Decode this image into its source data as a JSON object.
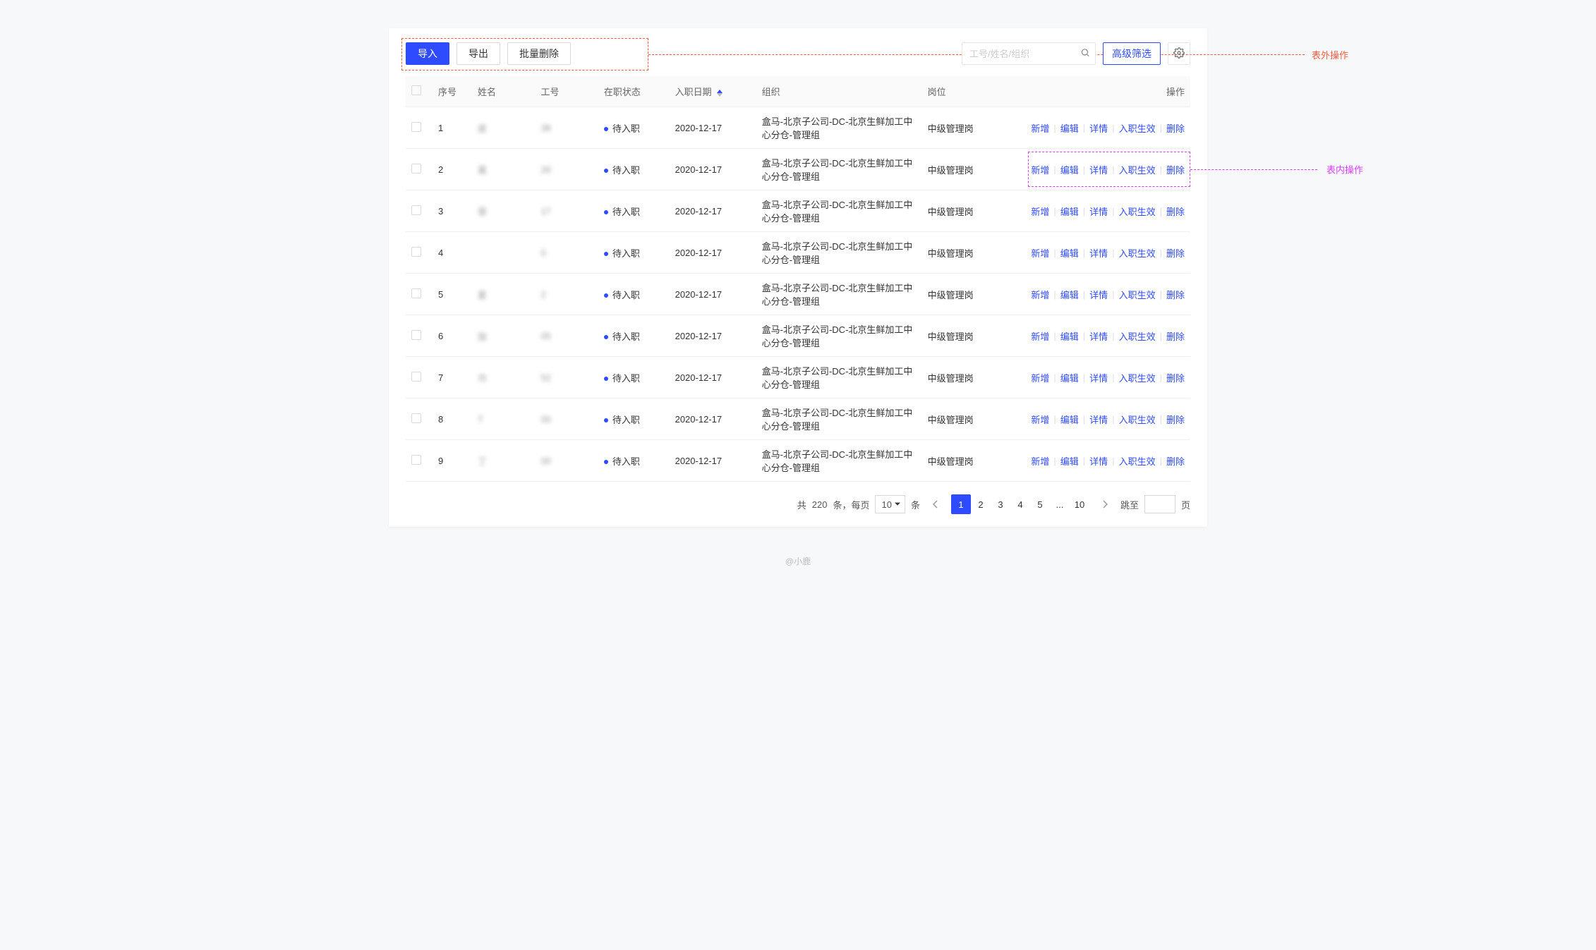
{
  "toolbar": {
    "import_label": "导入",
    "export_label": "导出",
    "bulk_delete_label": "批量删除",
    "search_placeholder": "工号/姓名/组织",
    "adv_filter_label": "高级筛选"
  },
  "annotations": {
    "outer_label": "表外操作",
    "inner_label": "表内操作"
  },
  "columns": {
    "idx": "序号",
    "name": "姓名",
    "empId": "工号",
    "status": "在职状态",
    "joinDate": "入职日期",
    "org": "组织",
    "position": "岗位",
    "action": "操作"
  },
  "rowActions": [
    "新增",
    "编辑",
    "详情",
    "入职生效",
    "删除"
  ],
  "rows": [
    {
      "idx": "1",
      "name": "皮",
      "empId": "38",
      "status": "待入职",
      "date": "2020-12-17",
      "org": "盒马-北京子公司-DC-北京生鲜加工中心分仓-管理组",
      "pos": "中级管理岗"
    },
    {
      "idx": "2",
      "name": "昊",
      "empId": "26",
      "status": "待入职",
      "date": "2020-12-17",
      "org": "盒马-北京子公司-DC-北京生鲜加工中心分仓-管理组",
      "pos": "中级管理岗"
    },
    {
      "idx": "3",
      "name": "菲",
      "empId": "17",
      "status": "待入职",
      "date": "2020-12-17",
      "org": "盒马-北京子公司-DC-北京生鲜加工中心分仓-管理组",
      "pos": "中级管理岗"
    },
    {
      "idx": "4",
      "name": "",
      "empId": "0",
      "status": "待入职",
      "date": "2020-12-17",
      "org": "盒马-北京子公司-DC-北京生鲜加工中心分仓-管理组",
      "pos": "中级管理岗"
    },
    {
      "idx": "5",
      "name": "星",
      "empId": "2",
      "status": "待入职",
      "date": "2020-12-17",
      "org": "盒马-北京子公司-DC-北京生鲜加工中心分仓-管理组",
      "pos": "中级管理岗"
    },
    {
      "idx": "6",
      "name": "加",
      "empId": "05",
      "status": "待入职",
      "date": "2020-12-17",
      "org": "盒马-北京子公司-DC-北京生鲜加工中心分仓-管理组",
      "pos": "中级管理岗"
    },
    {
      "idx": "7",
      "name": "巾",
      "empId": "52",
      "status": "待入职",
      "date": "2020-12-17",
      "org": "盒马-北京子公司-DC-北京生鲜加工中心分仓-管理组",
      "pos": "中级管理岗"
    },
    {
      "idx": "8",
      "name": "T",
      "empId": "00",
      "status": "待入职",
      "date": "2020-12-17",
      "org": "盒马-北京子公司-DC-北京生鲜加工中心分仓-管理组",
      "pos": "中级管理岗"
    },
    {
      "idx": "9",
      "name": "丁",
      "empId": "00",
      "status": "待入职",
      "date": "2020-12-17",
      "org": "盒马-北京子公司-DC-北京生鲜加工中心分仓-管理组",
      "pos": "中级管理岗"
    }
  ],
  "pagination": {
    "total_prefix": "共",
    "total_count": "220",
    "total_suffix": "条，每页",
    "page_size": "10",
    "page_size_suffix": "条",
    "pages": [
      "1",
      "2",
      "3",
      "4",
      "5",
      "...",
      "10"
    ],
    "active": "1",
    "jump_prefix": "跳至",
    "jump_suffix": "页"
  },
  "footer": "@小鹿"
}
